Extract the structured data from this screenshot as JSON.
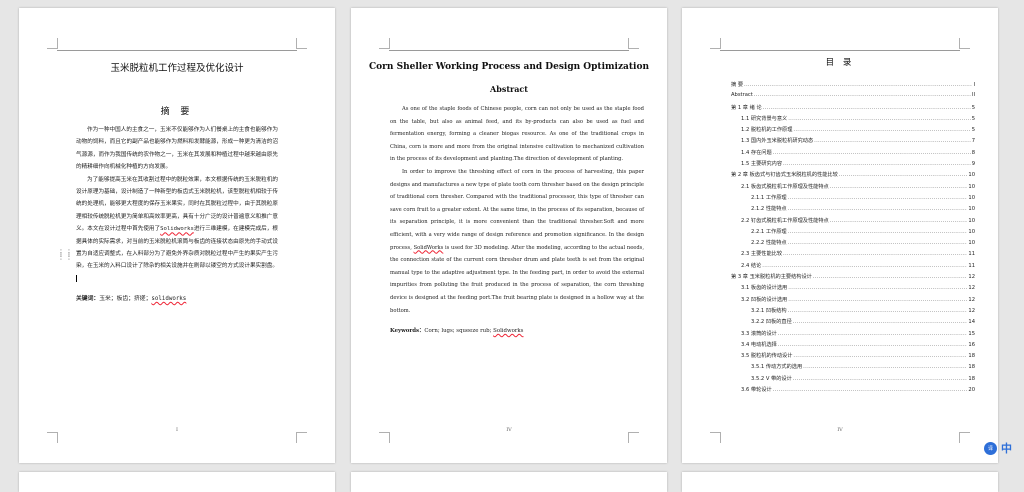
{
  "page1": {
    "title": "玉米脱粒机工作过程及优化设计",
    "abstract_heading": "摘 要",
    "paragraphs": [
      "作为一种中国人的主食之一，玉米不仅能够作为人们餐桌上的主食也能够作为动物的饲料，而且它的副产品也能够作为燃料和发酵能源，形成一种更为清洁的沼气源源，而作为我国传统的农作物之一，玉米在其发展和种植过程中越来越由原先的精耕细作向机械化种植的方向发展。",
      "为了能够提高玉米在其收割过程中的脱粒效果，本文根据传统的玉米脱粒机的设计原理为基础，设计制造了一种新型的板齿式玉米脱粒机，该型脱粒机相较于传统的处理机，能够更大程度的保存玉米果实，同时在其脱粒过程中，由于其脱粒原理相较传统脱粒机更为简单和高效率更高，具有十分广泛的设计普遍意义和推广意义。本文在设计过程中首先使用了"
    ],
    "paragraph2_software": "Solidworks",
    "paragraph2_rest": "进行三维建模，在建模完成后，根据具体的实际需求，对当前的玉米脱粒机滚筒与板齿的连接状态由原先的手动式设置为自适应调整式，在入料部分为了避免外界杂质对脱粒过程中产生的果实产生污染，在玉米的入料口设计了除杂的相关设施并在刷部以镂空的方式设计果实割盘。",
    "keywords_label": "关键词：",
    "keywords_text": "玉米；板齿；挤搓；",
    "keywords_software": "solidworks",
    "page_number": "I"
  },
  "page2": {
    "title": "Corn Sheller Working Process and Design Optimization",
    "abstract_heading": "Abstract",
    "paragraphs": [
      "As one of the staple foods of Chinese people, corn can not only be used as the staple food on the table, but also as animal feed, and its by-products can also be used as fuel and fermentation energy, forming a cleaner biogas resource. As one of the traditional crops in China, corn is more and more from the original intensive cultivation to mechanized cultivation in the process of its development and planting.The direction of development of planting.",
      "In order to improve the threshing effect of corn in the process of harvesting, this paper designs and manufactures a new type of plate tooth corn thresher based on the design principle of traditional corn thresher. Compared with the traditional processor, this type of thresher can save corn fruit to a greater extent. At the same time, in the process of its separation, because of its separation principle, it is more convenient than the traditional thresher.Soft and more efficient, with a very wide range of design reference and promotion significance. In the design process,"
    ],
    "paragraph2_software": "SolidWorks",
    "paragraph2_rest": " is used for 3D modeling. After the modeling, according to the actual needs, the connection state of the current corn thresher drum and plate teeth is set from the original manual type to the adaptive adjustment type. In the feeding part, in order to avoid the external impurities from polluting the fruit produced in the process of separation, the corn threshing device is designed at the feeding port.The fruit bearing plate is designed in a hollow way at the bottom.",
    "keywords_label": "Keywords：",
    "keywords_text": "Corn; lugs; squeeze rub; ",
    "keywords_software": "Solidworks",
    "page_number": "IV"
  },
  "page3": {
    "title": "目 录",
    "toc": [
      {
        "level": 1,
        "text": "摘  要",
        "page": "I"
      },
      {
        "level": 1,
        "text": "Abstract",
        "page": "II"
      },
      {
        "level": 1,
        "text": "第 1 章  绪  论",
        "page": "5"
      },
      {
        "level": 2,
        "text": "1.1 研究背景与意义",
        "page": "5"
      },
      {
        "level": 2,
        "text": "1.2 脱粒机的工作原理",
        "page": "5"
      },
      {
        "level": 2,
        "text": "1.3 国内外玉米脱粒机研究动态",
        "page": "7"
      },
      {
        "level": 2,
        "text": "1.4 存在问题",
        "page": "8"
      },
      {
        "level": 2,
        "text": "1.5 主要研究内容",
        "page": "9"
      },
      {
        "level": 1,
        "text": "第 2 章  板齿式与钉齿式玉米脱粒机的性能比较",
        "page": "10"
      },
      {
        "level": 2,
        "text": "2.1 板齿式脱粒机工作原理及性能特点",
        "page": "10"
      },
      {
        "level": 3,
        "text": "2.1.1 工作原理",
        "page": "10"
      },
      {
        "level": 3,
        "text": "2.1.2 性能特点",
        "page": "10"
      },
      {
        "level": 2,
        "text": "2.2 钉齿式脱粒机工作原理及性能特点",
        "page": "10"
      },
      {
        "level": 3,
        "text": "2.2.1 工作原理",
        "page": "10"
      },
      {
        "level": 3,
        "text": "2.2.2 性能特点",
        "page": "10"
      },
      {
        "level": 2,
        "text": "2.3 主要性能比较",
        "page": "11"
      },
      {
        "level": 2,
        "text": "2.4 结论",
        "page": "11"
      },
      {
        "level": 1,
        "text": "第 3 章  玉米脱粒机的主要结构设计",
        "page": "12"
      },
      {
        "level": 2,
        "text": "3.1 板齿的设计选用",
        "page": "12"
      },
      {
        "level": 2,
        "text": "3.2 凹板的设计选用",
        "page": "12"
      },
      {
        "level": 3,
        "text": "3.2.1 凹板结构",
        "page": "12"
      },
      {
        "level": 3,
        "text": "3.2.2 凹板的直径",
        "page": "14"
      },
      {
        "level": 2,
        "text": "3.3 滚筒的设计",
        "page": "15"
      },
      {
        "level": 2,
        "text": "3.4 电动机选择",
        "page": "16"
      },
      {
        "level": 2,
        "text": "3.5 脱粒机的传动设计",
        "page": "18"
      },
      {
        "level": 3,
        "text": "3.5.1 传动方式的选用",
        "page": "18"
      },
      {
        "level": 3,
        "text": "3.5.2 V 带的设计",
        "page": "18"
      },
      {
        "level": 2,
        "text": "3.6 带轮设计",
        "page": "20"
      }
    ],
    "page_number": "IV"
  },
  "translate": {
    "icon_text": "译",
    "label": "中"
  }
}
